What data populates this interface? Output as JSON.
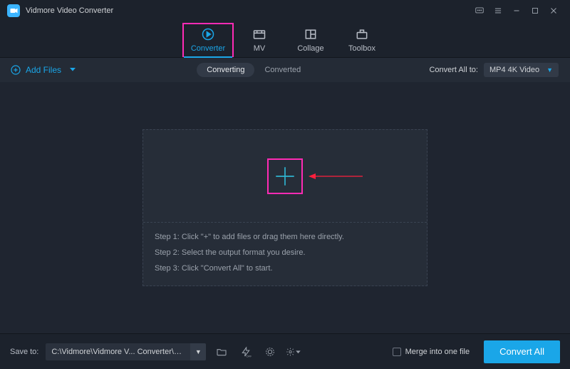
{
  "app": {
    "title": "Vidmore Video Converter"
  },
  "nav": {
    "tabs": [
      {
        "label": "Converter"
      },
      {
        "label": "MV"
      },
      {
        "label": "Collage"
      },
      {
        "label": "Toolbox"
      }
    ]
  },
  "subbar": {
    "add_files": "Add Files",
    "tabs": [
      {
        "label": "Converting"
      },
      {
        "label": "Converted"
      }
    ],
    "convert_all_to": "Convert All to:",
    "format": "MP4 4K Video"
  },
  "dropzone": {
    "steps": [
      "Step 1: Click \"+\" to add files or drag them here directly.",
      "Step 2: Select the output format you desire.",
      "Step 3: Click \"Convert All\" to start."
    ]
  },
  "bottom": {
    "save_to": "Save to:",
    "path": "C:\\Vidmore\\Vidmore V... Converter\\Converted",
    "merge": "Merge into one file",
    "convert_all": "Convert All"
  }
}
